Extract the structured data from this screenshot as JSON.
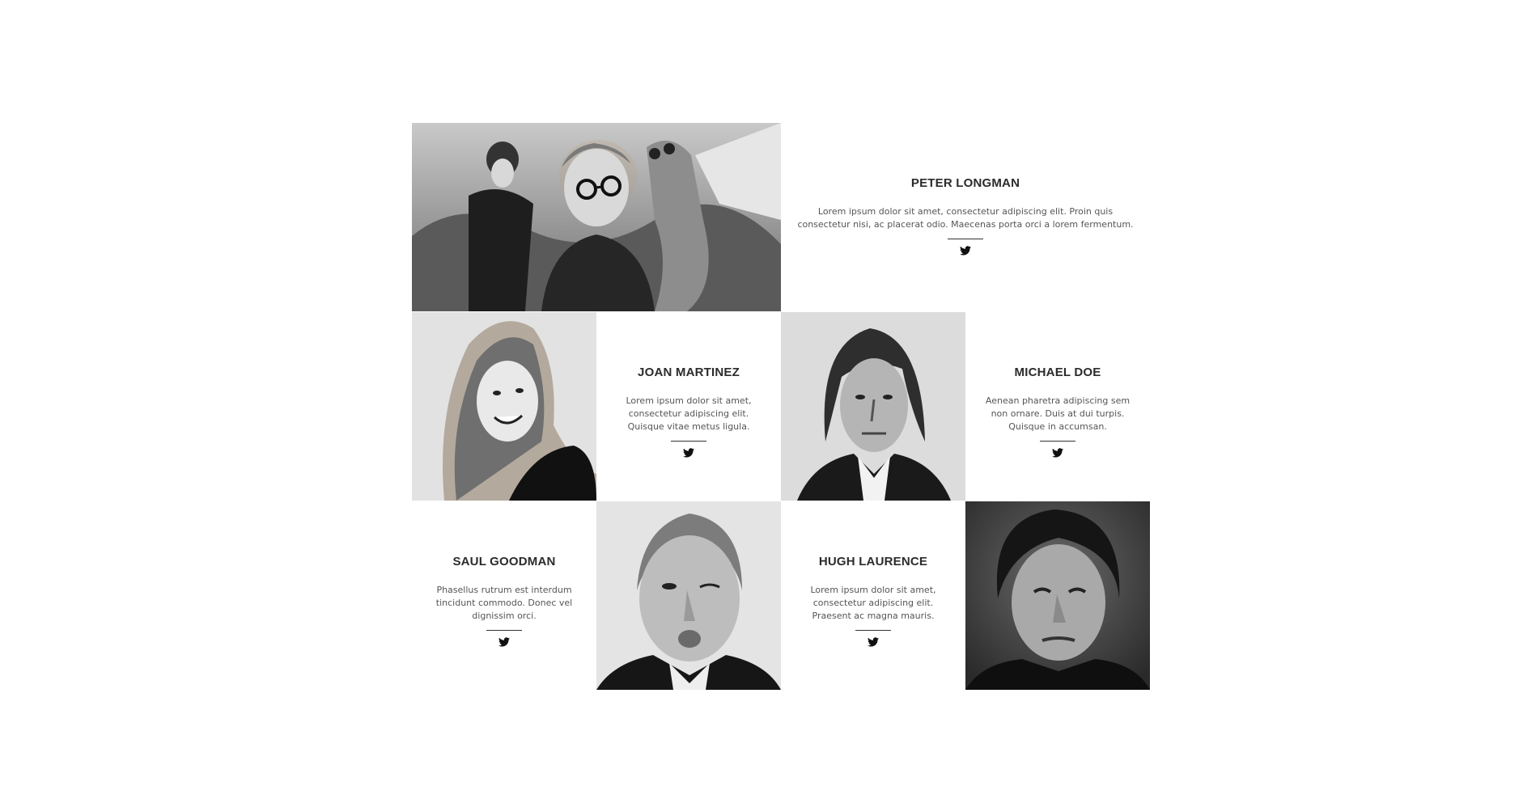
{
  "team": [
    {
      "name": "PETER LONGMAN",
      "bio": "Lorem ipsum dolor sit amet, consectetur adipiscing elit. Proin quis consectetur nisi, ac placerat odio. Maecenas porta orci a lorem fermentum.",
      "social_icon": "twitter-icon",
      "photo": "portrait-man-with-glasses-and-puppets"
    },
    {
      "name": "JOAN MARTINEZ",
      "bio": "Lorem ipsum dolor sit amet, consectetur adipiscing elit. Quisque vitae metus ligula.",
      "social_icon": "twitter-icon",
      "photo": "portrait-smiling-woman-long-hair"
    },
    {
      "name": "MICHAEL DOE",
      "bio": "Aenean pharetra adipiscing sem non ornare. Duis at dui turpis. Quisque in accumsan.",
      "social_icon": "twitter-icon",
      "photo": "portrait-man-long-hair"
    },
    {
      "name": "SAUL GOODMAN",
      "bio": "Phasellus rutrum est interdum tincidunt commodo. Donec vel dignissim orci.",
      "social_icon": "twitter-icon",
      "photo": "portrait-older-man-winking"
    },
    {
      "name": "HUGH LAURENCE",
      "bio": "Lorem ipsum dolor sit amet, consectetur adipiscing elit. Praesent ac magna mauris.",
      "social_icon": "twitter-icon",
      "photo": "portrait-man-curly-hair-grimace"
    }
  ],
  "colors": {
    "text_heading": "#2b2b2b",
    "text_body": "#555555",
    "photo_bg": "#dedede"
  }
}
